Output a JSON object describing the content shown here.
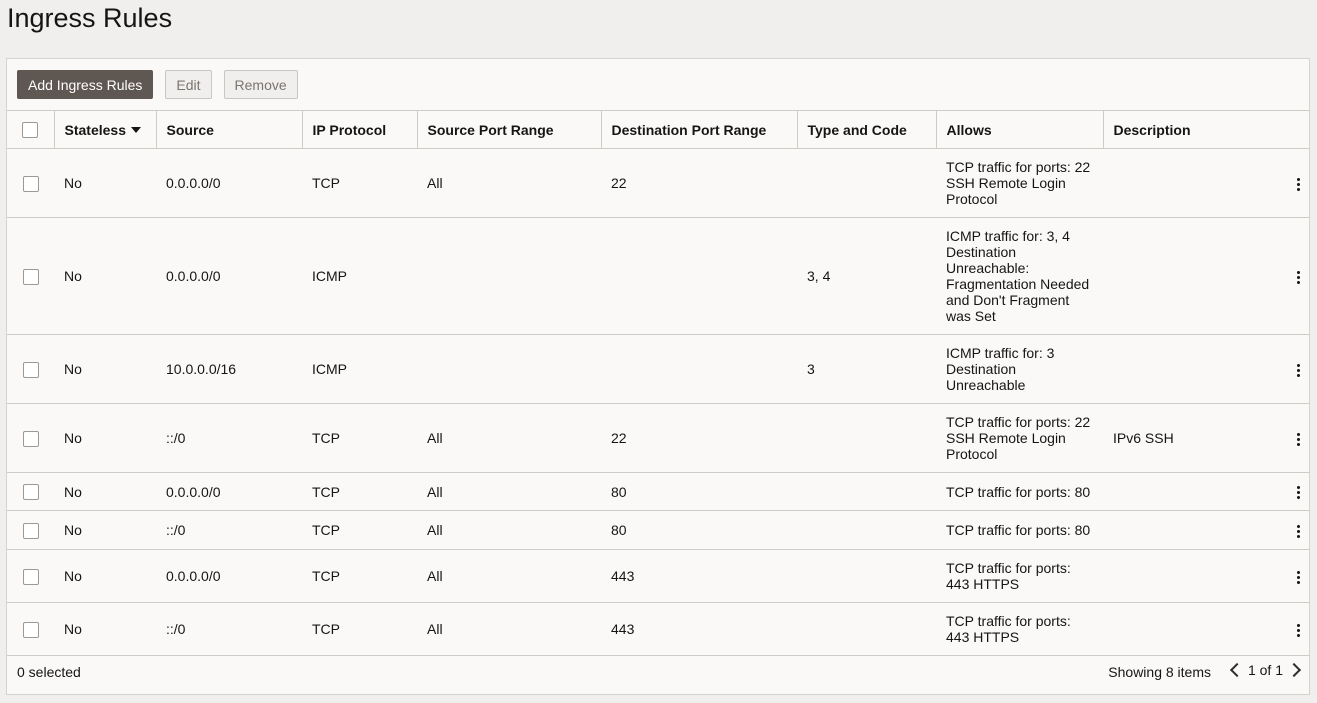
{
  "page": {
    "title": "Ingress Rules"
  },
  "toolbar": {
    "add_label": "Add Ingress Rules",
    "edit_label": "Edit",
    "remove_label": "Remove"
  },
  "table": {
    "columns": {
      "stateless": "Stateless",
      "source": "Source",
      "ip_protocol": "IP Protocol",
      "source_port_range": "Source Port Range",
      "destination_port_range": "Destination Port Range",
      "type_and_code": "Type and Code",
      "allows": "Allows",
      "description": "Description"
    },
    "rows": [
      {
        "stateless": "No",
        "source": "0.0.0.0/0",
        "protocol": "TCP",
        "src_ports": "All",
        "dst_ports": "22",
        "type_code": "",
        "allows": "TCP traffic for ports: 22 SSH Remote Login Protocol",
        "description": ""
      },
      {
        "stateless": "No",
        "source": "0.0.0.0/0",
        "protocol": "ICMP",
        "src_ports": "",
        "dst_ports": "",
        "type_code": "3, 4",
        "allows": "ICMP traffic for: 3, 4 Destination Unreachable: Fragmentation Needed and Don't Fragment was Set",
        "description": ""
      },
      {
        "stateless": "No",
        "source": "10.0.0.0/16",
        "protocol": "ICMP",
        "src_ports": "",
        "dst_ports": "",
        "type_code": "3",
        "allows": "ICMP traffic for: 3 Destination Unreachable",
        "description": ""
      },
      {
        "stateless": "No",
        "source": "::/0",
        "protocol": "TCP",
        "src_ports": "All",
        "dst_ports": "22",
        "type_code": "",
        "allows": "TCP traffic for ports: 22 SSH Remote Login Protocol",
        "description": "IPv6 SSH"
      },
      {
        "stateless": "No",
        "source": "0.0.0.0/0",
        "protocol": "TCP",
        "src_ports": "All",
        "dst_ports": "80",
        "type_code": "",
        "allows": "TCP traffic for ports: 80",
        "description": ""
      },
      {
        "stateless": "No",
        "source": "::/0",
        "protocol": "TCP",
        "src_ports": "All",
        "dst_ports": "80",
        "type_code": "",
        "allows": "TCP traffic for ports: 80",
        "description": ""
      },
      {
        "stateless": "No",
        "source": "0.0.0.0/0",
        "protocol": "TCP",
        "src_ports": "All",
        "dst_ports": "443",
        "type_code": "",
        "allows": "TCP traffic for ports: 443 HTTPS",
        "description": ""
      },
      {
        "stateless": "No",
        "source": "::/0",
        "protocol": "TCP",
        "src_ports": "All",
        "dst_ports": "443",
        "type_code": "",
        "allows": "TCP traffic for ports: 443 HTTPS",
        "description": ""
      }
    ]
  },
  "footer": {
    "selected": "0 selected",
    "showing": "Showing 8 items",
    "page_info": "1 of 1"
  }
}
